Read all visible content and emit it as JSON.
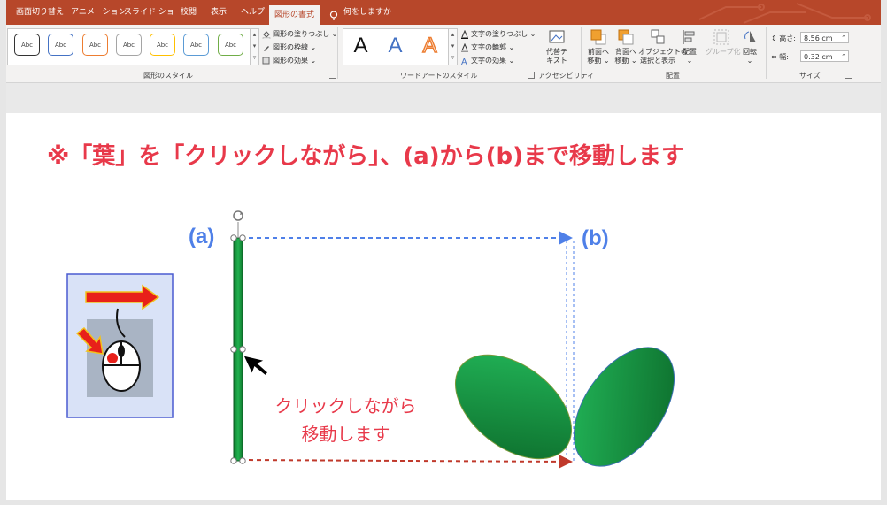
{
  "ribbon": {
    "tabs": [
      "画面切り替え",
      "アニメーション",
      "スライド ショー",
      "校閲",
      "表示",
      "ヘルプ",
      "図形の書式"
    ],
    "active_tab": "図形の書式",
    "tell_me": "何をしますか",
    "shape_styles": {
      "swatch_text": "Abc",
      "swatch_colors": [
        "#333333",
        "#4472c4",
        "#ed7d31",
        "#a5a5a5",
        "#ffc000",
        "#5b9bd5",
        "#70ad47"
      ],
      "fill": "図形の塗りつぶし",
      "outline": "図形の枠線",
      "effects": "図形の効果",
      "group_label": "図形のスタイル"
    },
    "wordart": {
      "samples": [
        "A",
        "A",
        "A"
      ],
      "text_fill": "文字の塗りつぶし",
      "text_outline": "文字の輪郭",
      "text_effects": "文字の効果",
      "group_label": "ワードアートのスタイル"
    },
    "accessibility": {
      "alt_text_line1": "代替テ",
      "alt_text_line2": "キスト",
      "group_label": "アクセシビリティ"
    },
    "arrange": {
      "bring_forward_1": "前面へ",
      "bring_forward_2": "移動",
      "send_backward_1": "背面へ",
      "send_backward_2": "移動",
      "selection_1": "オブジェクトの",
      "selection_2": "選択と表示",
      "align": "配置",
      "group": "グループ化",
      "rotate": "回転",
      "group_label": "配置"
    },
    "size": {
      "height_label": "高さ:",
      "height_value": "8.56 cm",
      "width_label": "幅:",
      "width_value": "0.32 cm",
      "group_label": "サイズ"
    }
  },
  "slide": {
    "heading": "※「葉」を「クリックしながら」、(a)から(b)まで移動します",
    "label_a": "(a)",
    "label_b": "(b)",
    "caption_line1": "クリックしながら",
    "caption_line2": "移動します"
  },
  "colors": {
    "ribbon_red": "#b7472a",
    "accent_red": "#e8394a",
    "label_blue": "#4f80e8",
    "leaf_green": "#1aa04a"
  }
}
